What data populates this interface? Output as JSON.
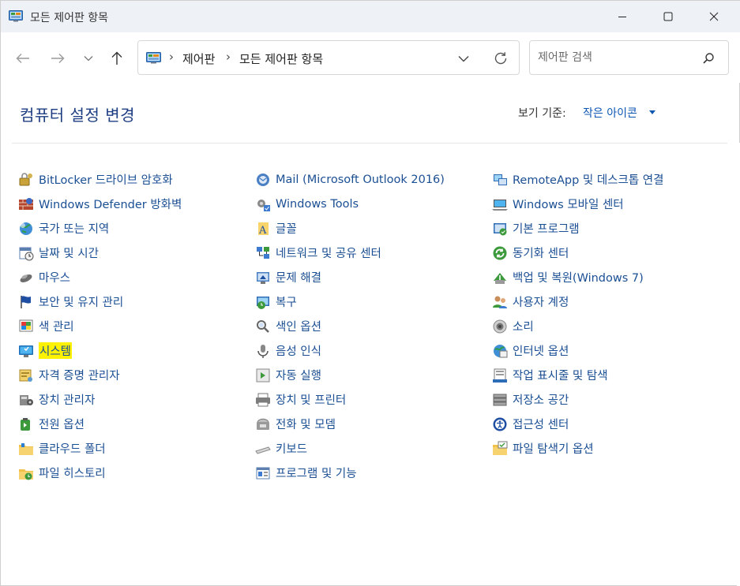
{
  "window": {
    "title": "모든 제어판 항목",
    "minimize_label": "—",
    "maximize_label": "☐",
    "close_label": "✕"
  },
  "address": {
    "crumbs": [
      "제어판",
      "모든 제어판 항목"
    ],
    "separator": "›"
  },
  "search": {
    "placeholder": "제어판 검색"
  },
  "header": {
    "title": "컴퓨터 설정 변경",
    "view_by_label": "보기 기준:",
    "view_by_value": "작은 아이콘"
  },
  "columns": [
    [
      {
        "label": "BitLocker 드라이브 암호화",
        "icon": "bitlocker-icon"
      },
      {
        "label": "Windows Defender 방화벽",
        "icon": "firewall-icon"
      },
      {
        "label": "국가 또는 지역",
        "icon": "region-icon"
      },
      {
        "label": "날짜 및 시간",
        "icon": "datetime-icon"
      },
      {
        "label": "마우스",
        "icon": "mouse-icon"
      },
      {
        "label": "보안 및 유지 관리",
        "icon": "flag-icon"
      },
      {
        "label": "색 관리",
        "icon": "color-management-icon"
      },
      {
        "label": "시스템",
        "icon": "system-icon",
        "highlighted": true
      },
      {
        "label": "자격 증명 관리자",
        "icon": "credential-icon"
      },
      {
        "label": "장치 관리자",
        "icon": "device-manager-icon"
      },
      {
        "label": "전원 옵션",
        "icon": "power-icon"
      },
      {
        "label": "클라우드 폴더",
        "icon": "cloud-folder-icon"
      },
      {
        "label": "파일 히스토리",
        "icon": "file-history-icon"
      }
    ],
    [
      {
        "label": "Mail (Microsoft Outlook 2016)",
        "icon": "mail-icon"
      },
      {
        "label": "Windows Tools",
        "icon": "windows-tools-icon"
      },
      {
        "label": "글꼴",
        "icon": "font-icon"
      },
      {
        "label": "네트워크 및 공유 센터",
        "icon": "network-icon"
      },
      {
        "label": "문제 해결",
        "icon": "troubleshoot-icon"
      },
      {
        "label": "복구",
        "icon": "recovery-icon"
      },
      {
        "label": "색인 옵션",
        "icon": "indexing-icon"
      },
      {
        "label": "음성 인식",
        "icon": "microphone-icon"
      },
      {
        "label": "자동 실행",
        "icon": "autoplay-icon"
      },
      {
        "label": "장치 및 프린터",
        "icon": "printer-icon"
      },
      {
        "label": "전화 및 모뎀",
        "icon": "phone-icon"
      },
      {
        "label": "키보드",
        "icon": "keyboard-icon"
      },
      {
        "label": "프로그램 및 기능",
        "icon": "programs-icon"
      }
    ],
    [
      {
        "label": "RemoteApp 및 데스크톱 연결",
        "icon": "remoteapp-icon"
      },
      {
        "label": "Windows 모바일 센터",
        "icon": "mobility-icon"
      },
      {
        "label": "기본 프로그램",
        "icon": "default-programs-icon"
      },
      {
        "label": "동기화 센터",
        "icon": "sync-icon"
      },
      {
        "label": "백업 및 복원(Windows 7)",
        "icon": "backup-icon"
      },
      {
        "label": "사용자 계정",
        "icon": "users-icon"
      },
      {
        "label": "소리",
        "icon": "speaker-icon"
      },
      {
        "label": "인터넷 옵션",
        "icon": "internet-icon"
      },
      {
        "label": "작업 표시줄 및 탐색",
        "icon": "taskbar-icon"
      },
      {
        "label": "저장소 공간",
        "icon": "storage-icon"
      },
      {
        "label": "접근성 센터",
        "icon": "accessibility-icon"
      },
      {
        "label": "파일 탐색기 옵션",
        "icon": "folder-options-icon"
      }
    ]
  ],
  "colors": {
    "title": "#1e3e83",
    "link": "#1b4f94",
    "accent": "#0d57b3",
    "highlight": "#fff200",
    "titlebar": "#eef1f6"
  }
}
